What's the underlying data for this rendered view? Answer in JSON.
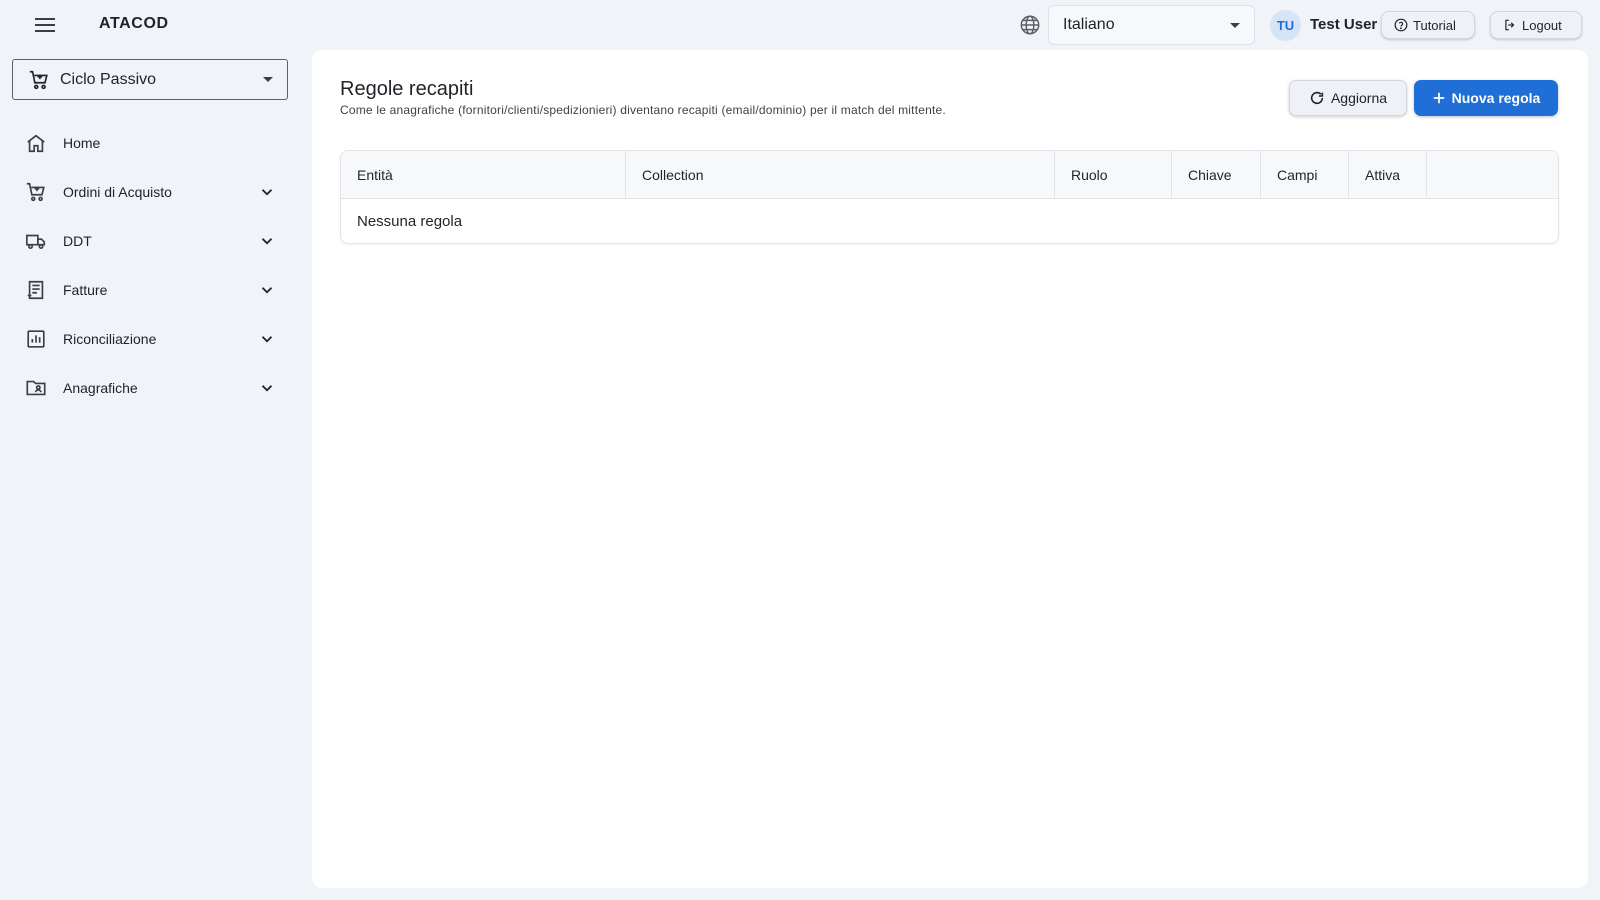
{
  "topbar": {
    "app_title": "ATACOD",
    "language": "Italiano",
    "user_initials": "TU",
    "user_name": "Test User",
    "tutorial_label": "Tutorial",
    "logout_label": "Logout"
  },
  "sidebar": {
    "cycle": "Ciclo Passivo",
    "items": [
      {
        "label": "Home",
        "icon": "home-icon",
        "expandable": false
      },
      {
        "label": "Ordini di Acquisto",
        "icon": "cart-icon",
        "expandable": true
      },
      {
        "label": "DDT",
        "icon": "truck-icon",
        "expandable": true
      },
      {
        "label": "Fatture",
        "icon": "invoice-icon",
        "expandable": true
      },
      {
        "label": "Riconciliazione",
        "icon": "analytics-icon",
        "expandable": true
      },
      {
        "label": "Anagrafiche",
        "icon": "contact-folder-icon",
        "expandable": true
      }
    ]
  },
  "main": {
    "title": "Regole recapiti",
    "subtitle": "Come le anagrafiche (fornitori/clienti/spedizionieri) diventano recapiti (email/dominio) per il match del mittente.",
    "refresh_label": "Aggiorna",
    "new_label": "Nuova regola",
    "table": {
      "columns": [
        "Entità",
        "Collection",
        "Ruolo",
        "Chiave",
        "Campi",
        "Attiva",
        ""
      ],
      "empty_text": "Nessuna regola"
    }
  },
  "colors": {
    "accent": "#1f6fd6",
    "background": "#f0f3f7",
    "panel": "#ffffff"
  }
}
